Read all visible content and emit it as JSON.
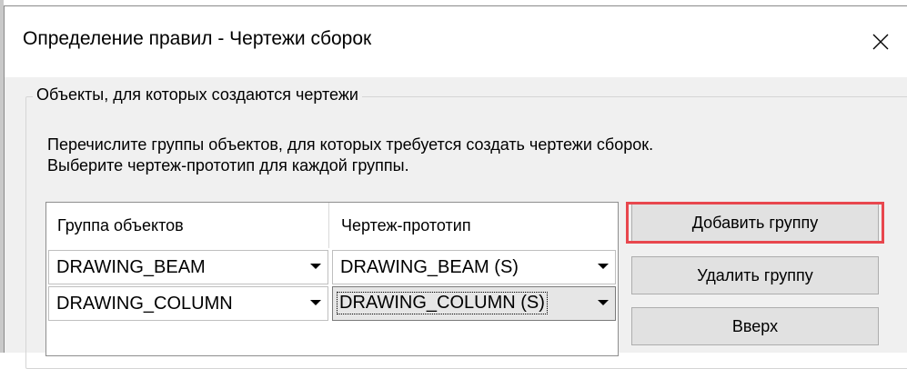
{
  "dialog": {
    "title": "Определение правил - Чертежи сборок"
  },
  "groupbox": {
    "legend": "Объекты, для которых создаются чертежи",
    "description_line1": "Перечислите группы объектов, для которых требуется создать чертежи сборок.",
    "description_line2": "Выберите чертеж-прототип для каждой группы."
  },
  "table": {
    "headers": [
      "Группа объектов",
      "Чертеж-прототип"
    ],
    "rows": [
      {
        "group": "DRAWING_BEAM",
        "prototype": "DRAWING_BEAM (S)"
      },
      {
        "group": "DRAWING_COLUMN",
        "prototype": "DRAWING_COLUMN (S)"
      }
    ]
  },
  "buttons": {
    "add_group": "Добавить группу",
    "remove_group": "Удалить группу",
    "move_up": "Вверх"
  },
  "colors": {
    "highlight": "#e8474e"
  }
}
